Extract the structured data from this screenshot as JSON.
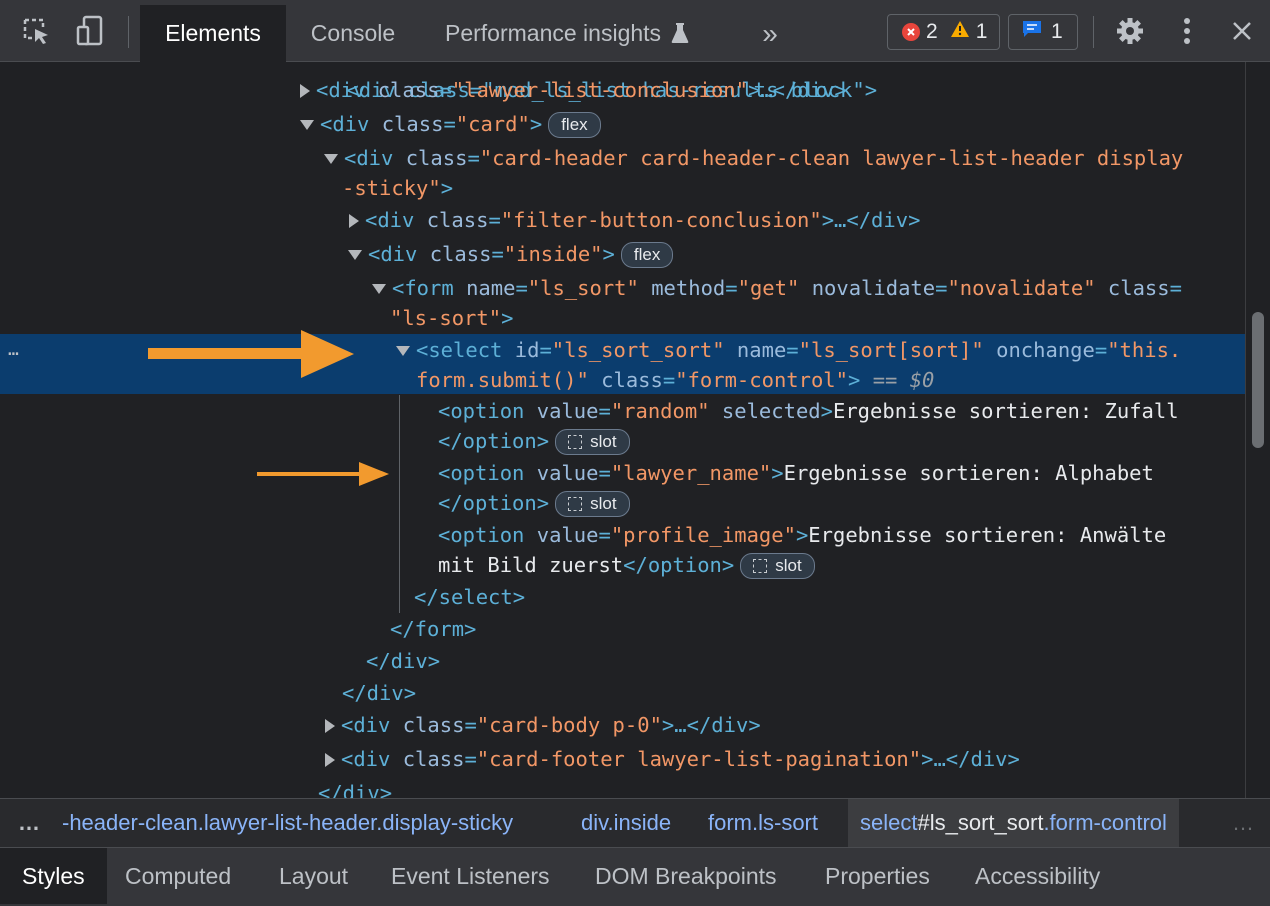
{
  "toolbar": {
    "icons": [
      "inspect-element-icon",
      "device-toggle-icon",
      "more-tabs-icon",
      "settings-icon",
      "kebab-menu-icon",
      "close-icon"
    ],
    "tabs": [
      {
        "label": "Elements",
        "active": true
      },
      {
        "label": "Console",
        "active": false
      },
      {
        "label": "Performance insights",
        "active": false,
        "icon": "flask-icon"
      }
    ],
    "overflow_label": "»",
    "errors": "2",
    "warnings": "1",
    "messages": "1",
    "colors": {
      "error": "#e8453c",
      "warning": "#f9ab00",
      "info": "#1a73e8"
    }
  },
  "tree": {
    "partial_top": "<div class=\"mod_ls_list has-results block\">",
    "lines": {
      "l1": {
        "tag": "<div",
        "attr": "class",
        "val": "\"lawyer-list-conclusion\"",
        "close": ">…</div>"
      },
      "l2": {
        "tag": "<div",
        "attr": "class",
        "val": "\"card\"",
        "close": ">",
        "badge": "flex"
      },
      "l3a": {
        "tag": "<div",
        "attr": "class",
        "val": "\"card-header card-header-clean lawyer-list-header display"
      },
      "l3b": {
        "val": "-sticky\"",
        "close": ">"
      },
      "l4": {
        "tag": "<div",
        "attr": "class",
        "val": "\"filter-button-conclusion\"",
        "close": ">…</div>"
      },
      "l5": {
        "tag": "<div",
        "attr": "class",
        "val": "\"inside\"",
        "close": ">",
        "badge": "flex"
      },
      "l6a": {
        "tag": "<form",
        "a1": "name",
        "v1": "\"ls_sort\"",
        "a2": "method",
        "v2": "\"get\"",
        "a3": "novalidate",
        "v3": "\"novalidate\"",
        "a4": "class"
      },
      "l6b": {
        "val": "\"ls-sort\"",
        "close": ">"
      },
      "l7a": {
        "tag": "<select",
        "a1": "id",
        "v1": "\"ls_sort_sort\"",
        "a2": "name",
        "v2": "\"ls_sort[sort]\"",
        "a3": "onchange",
        "v3": "\"this."
      },
      "l7b": {
        "v": "form.submit()\"",
        "a": "class",
        "v2": "\"form-control\"",
        "close": ">",
        "eq": "==",
        "ref": "$0"
      },
      "o1a": {
        "tag": "<option",
        "a1": "value",
        "v1": "\"random\"",
        "a2": "selected",
        "close": ">",
        "text": "Ergebnisse sortieren: Zufall"
      },
      "o1b": {
        "close": "</option>",
        "badge": "slot"
      },
      "o2a": {
        "tag": "<option",
        "a1": "value",
        "v1": "\"lawyer_name\"",
        "close": ">",
        "text": "Ergebnisse sortieren: Alphabet"
      },
      "o2b": {
        "close": "</option>",
        "badge": "slot"
      },
      "o3a": {
        "tag": "<option",
        "a1": "value",
        "v1": "\"profile_image\"",
        "close": ">",
        "text": "Ergebnisse sortieren: Anwälte"
      },
      "o3b": {
        "text": "mit Bild zuerst",
        "close": "</option>",
        "badge": "slot"
      },
      "c1": "</select>",
      "c2": "</form>",
      "c3": "</div>",
      "c4": "</div>",
      "l8": {
        "tag": "<div",
        "attr": "class",
        "val": "\"card-body p-0\"",
        "close": ">…</div>"
      },
      "l9": {
        "tag": "<div",
        "attr": "class",
        "val": "\"card-footer lawyer-list-pagination\"",
        "close": ">…</div>"
      },
      "c5": "</div>"
    },
    "row_dots": "…",
    "arrow_color": "#f29a2e"
  },
  "breadcrumb": {
    "more": "…",
    "items": [
      {
        "text": "-header-clean.lawyer-list-header.display-sticky"
      },
      {
        "text": "div.inside"
      },
      {
        "text": "form.ls-sort"
      },
      {
        "tag": "select",
        "rest": "#ls_sort_sort",
        "cls": ".form-control"
      }
    ],
    "more_right": "…"
  },
  "bottom_tabs": [
    "Styles",
    "Computed",
    "Layout",
    "Event Listeners",
    "DOM Breakpoints",
    "Properties",
    "Accessibility"
  ]
}
